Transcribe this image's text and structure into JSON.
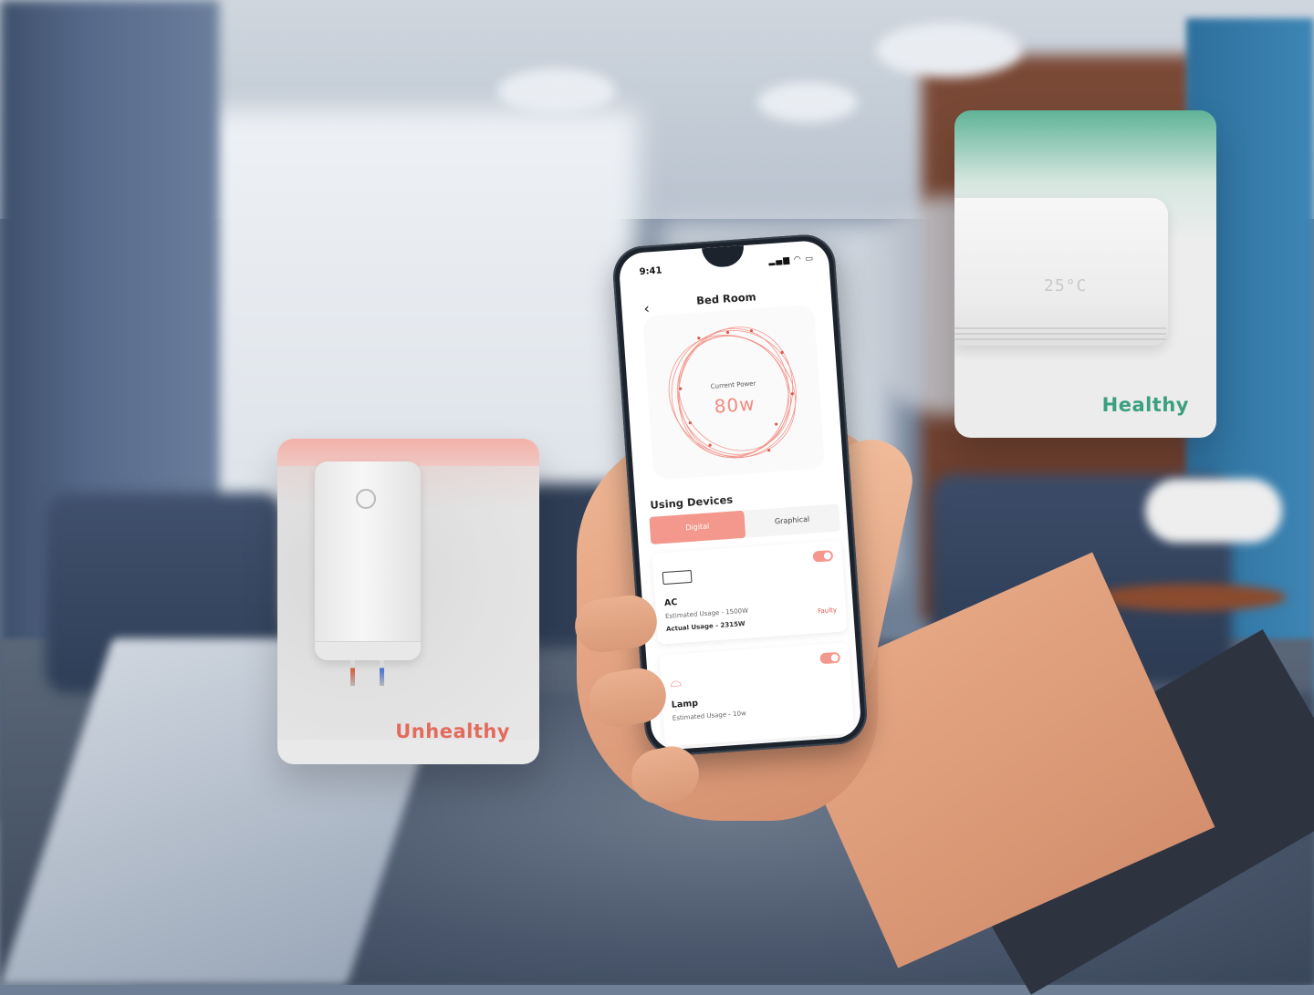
{
  "overlay_cards": {
    "unhealthy": {
      "status": "Unhealthy",
      "color": "#e36b5c"
    },
    "healthy": {
      "status": "Healthy",
      "color": "#3aa07f",
      "ac_display": "25°C"
    }
  },
  "phone": {
    "status_bar": {
      "time": "9:41",
      "icons": "▂▄▆ ◠ ▭"
    },
    "header": {
      "back_icon": "‹",
      "title": "Bed Room"
    },
    "power": {
      "label": "Current Power",
      "value": "80w",
      "accent": "#f28b80"
    },
    "devices_section": {
      "title": "Using Devices",
      "tabs": [
        {
          "label": "Digital",
          "active": true
        },
        {
          "label": "Graphical",
          "active": false
        }
      ],
      "devices": [
        {
          "name": "AC",
          "icon": "ac-icon",
          "estimated": "Estimated Usage - 1500W",
          "actual": "Actual Usage - 2315W",
          "status": "Faulty",
          "toggle_on": true
        },
        {
          "name": "Lamp",
          "icon": "lamp-icon",
          "estimated": "Estimated Usage - 10w",
          "actual": "",
          "status": "",
          "toggle_on": true
        }
      ]
    }
  }
}
